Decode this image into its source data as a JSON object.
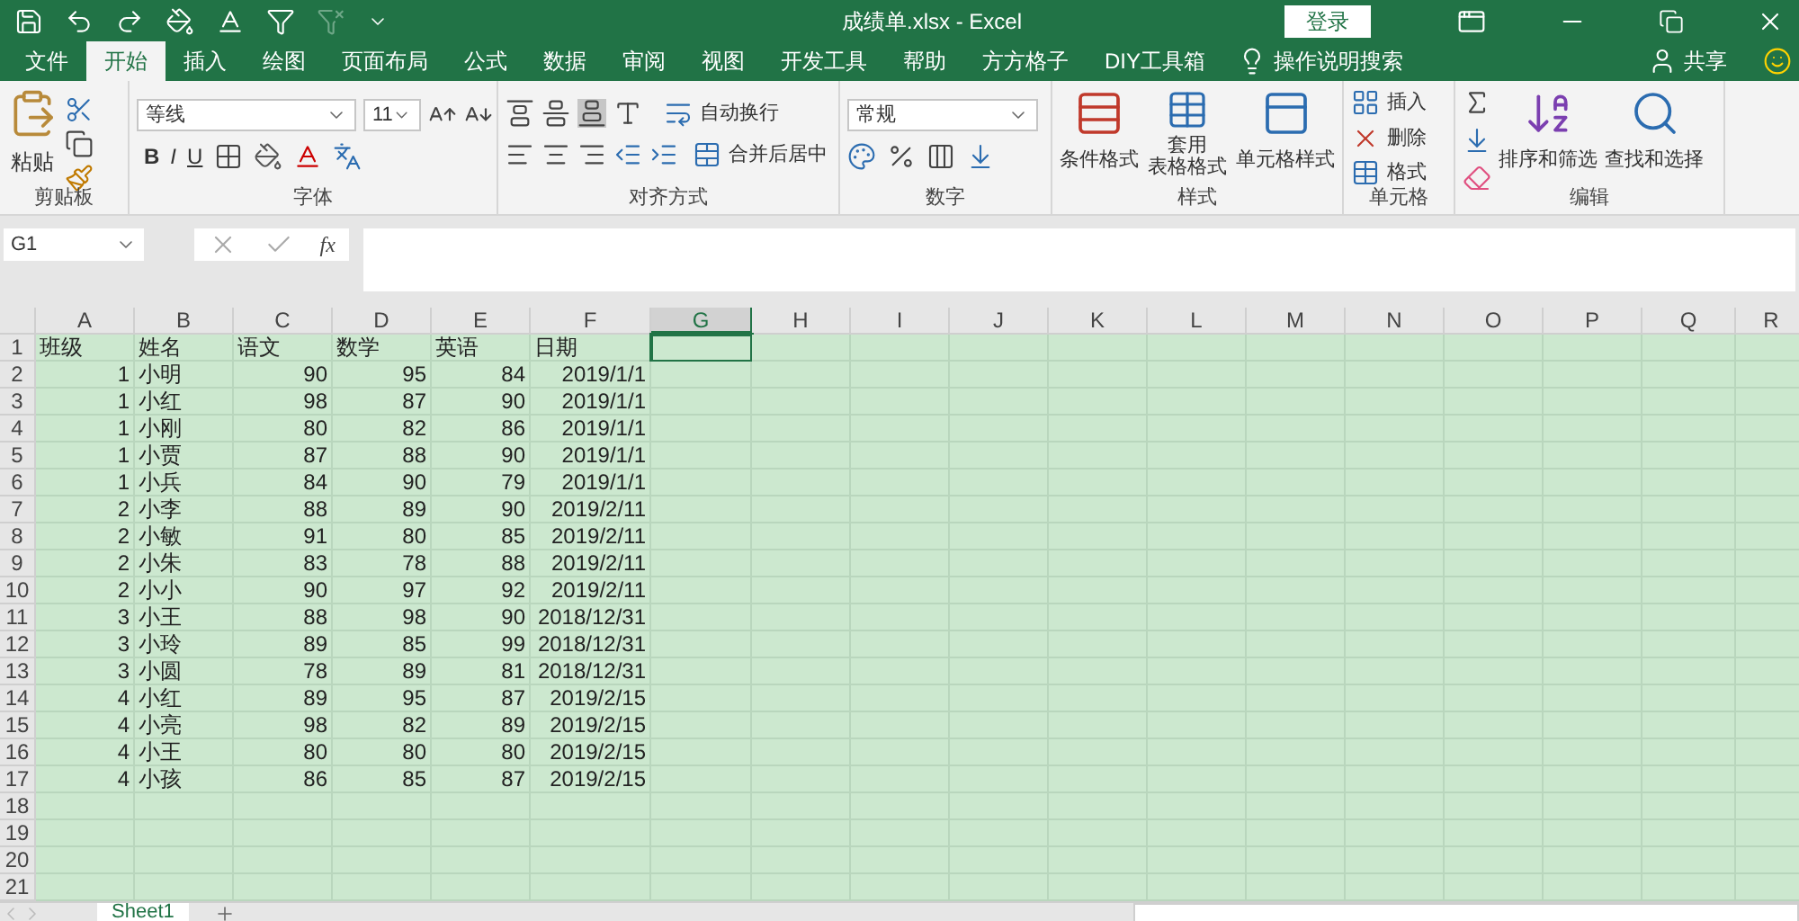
{
  "window": {
    "title": "成绩单.xlsx  -  Excel",
    "login": "登录"
  },
  "tabs": [
    {
      "label": "文件",
      "selected": false
    },
    {
      "label": "开始",
      "selected": true
    },
    {
      "label": "插入",
      "selected": false
    },
    {
      "label": "绘图",
      "selected": false
    },
    {
      "label": "页面布局",
      "selected": false
    },
    {
      "label": "公式",
      "selected": false
    },
    {
      "label": "数据",
      "selected": false
    },
    {
      "label": "审阅",
      "selected": false
    },
    {
      "label": "视图",
      "selected": false
    },
    {
      "label": "开发工具",
      "selected": false
    },
    {
      "label": "帮助",
      "selected": false
    },
    {
      "label": "方方格子",
      "selected": false
    },
    {
      "label": "DIY工具箱",
      "selected": false
    }
  ],
  "tell_me": "操作说明搜索",
  "share": "共享",
  "ribbon": {
    "clipboard": {
      "paste": "粘贴",
      "label": "剪贴板"
    },
    "font": {
      "name": "等线",
      "size": "11",
      "bold": "B",
      "italic": "I",
      "underline": "U",
      "label": "字体"
    },
    "alignment": {
      "wrap": "自动换行",
      "merge": "合并后居中",
      "label": "对齐方式"
    },
    "number": {
      "format": "常规",
      "label": "数字"
    },
    "styles": {
      "conditional": "条件格式",
      "table_line1": "套用",
      "table_line2": "表格格式",
      "cell_styles": "单元格样式",
      "label": "样式"
    },
    "cells": {
      "insert": "插入",
      "delete": "删除",
      "format": "格式",
      "label": "单元格"
    },
    "editing": {
      "sort": "排序和筛选",
      "find": "查找和选择",
      "label": "编辑"
    }
  },
  "formula_bar": {
    "name_box": "G1",
    "function": "fx"
  },
  "columns": [
    {
      "label": "A",
      "selected": false
    },
    {
      "label": "B",
      "selected": false
    },
    {
      "label": "C",
      "selected": false
    },
    {
      "label": "D",
      "selected": false
    },
    {
      "label": "E",
      "selected": false
    },
    {
      "label": "F",
      "selected": false
    },
    {
      "label": "G",
      "selected": true
    },
    {
      "label": "H",
      "selected": false
    },
    {
      "label": "I",
      "selected": false
    },
    {
      "label": "J",
      "selected": false
    },
    {
      "label": "K",
      "selected": false
    },
    {
      "label": "L",
      "selected": false
    },
    {
      "label": "M",
      "selected": false
    },
    {
      "label": "N",
      "selected": false
    },
    {
      "label": "O",
      "selected": false
    },
    {
      "label": "P",
      "selected": false
    },
    {
      "label": "Q",
      "selected": false
    },
    {
      "label": "R",
      "selected": false
    }
  ],
  "header": [
    "班级",
    "姓名",
    "语文",
    "数学",
    "英语",
    "日期"
  ],
  "rows": [
    [
      "1",
      "小明",
      "90",
      "95",
      "84",
      "2019/1/1"
    ],
    [
      "1",
      "小红",
      "98",
      "87",
      "90",
      "2019/1/1"
    ],
    [
      "1",
      "小刚",
      "80",
      "82",
      "86",
      "2019/1/1"
    ],
    [
      "1",
      "小贾",
      "87",
      "88",
      "90",
      "2019/1/1"
    ],
    [
      "1",
      "小兵",
      "84",
      "90",
      "79",
      "2019/1/1"
    ],
    [
      "2",
      "小李",
      "88",
      "89",
      "90",
      "2019/2/11"
    ],
    [
      "2",
      "小敏",
      "91",
      "80",
      "85",
      "2019/2/11"
    ],
    [
      "2",
      "小朱",
      "83",
      "78",
      "88",
      "2019/2/11"
    ],
    [
      "2",
      "小小",
      "90",
      "97",
      "92",
      "2019/2/11"
    ],
    [
      "3",
      "小王",
      "88",
      "98",
      "90",
      "2018/12/31"
    ],
    [
      "3",
      "小玲",
      "89",
      "85",
      "99",
      "2018/12/31"
    ],
    [
      "3",
      "小圆",
      "78",
      "89",
      "81",
      "2018/12/31"
    ],
    [
      "4",
      "小红",
      "89",
      "95",
      "87",
      "2019/2/15"
    ],
    [
      "4",
      "小亮",
      "98",
      "82",
      "89",
      "2019/2/15"
    ],
    [
      "4",
      "小王",
      "80",
      "80",
      "80",
      "2019/2/15"
    ],
    [
      "4",
      "小孩",
      "86",
      "85",
      "87",
      "2019/2/15"
    ]
  ],
  "row_numbers": [
    "1",
    "2",
    "3",
    "4",
    "5",
    "6",
    "7",
    "8",
    "9",
    "10",
    "11",
    "12",
    "13",
    "14",
    "15",
    "16",
    "17",
    "18",
    "19",
    "20",
    "21"
  ],
  "sheets": [
    {
      "label": "Sheet1",
      "selected": true
    }
  ]
}
